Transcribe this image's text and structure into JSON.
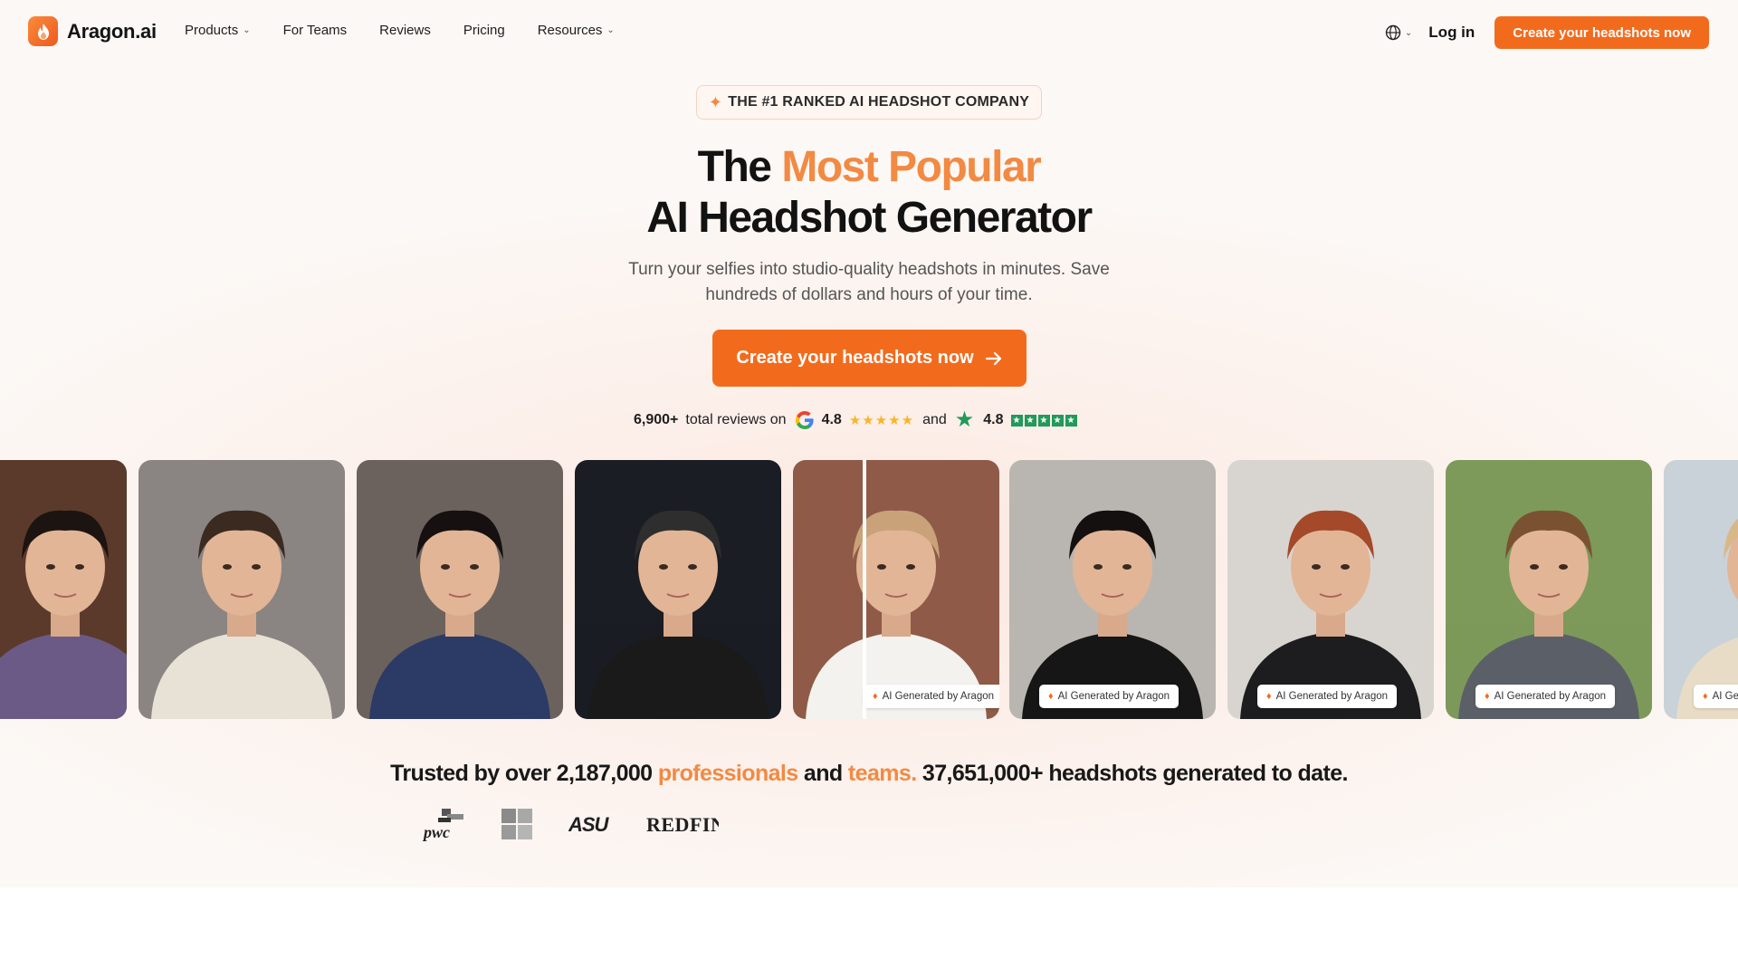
{
  "nav": {
    "brand": "Aragon.ai",
    "links": [
      {
        "label": "Products",
        "dropdown": true
      },
      {
        "label": "For Teams",
        "dropdown": false
      },
      {
        "label": "Reviews",
        "dropdown": false
      },
      {
        "label": "Pricing",
        "dropdown": false
      },
      {
        "label": "Resources",
        "dropdown": true
      }
    ],
    "login": "Log in",
    "cta": "Create your headshots now"
  },
  "hero": {
    "badge": "THE #1 RANKED AI HEADSHOT COMPANY",
    "title_prefix": "The ",
    "title_accent": "Most Popular",
    "title_line2": "AI Headshot Generator",
    "subtitle": "Turn your selfies into studio-quality headshots in minutes. Save hundreds of dollars and hours of your time.",
    "cta": "Create your headshots now"
  },
  "reviews": {
    "count": "6,900+",
    "text": "total reviews on",
    "google_rating": "4.8",
    "joiner": "and",
    "trustpilot_rating": "4.8"
  },
  "carousel": {
    "ai_label": "AI Generated by Aragon",
    "cards": [
      {
        "type": "selfie",
        "bg": "#5b3a2c",
        "shirt": "#6b5a86",
        "hair": "#1c1410"
      },
      {
        "type": "selfie",
        "bg": "#8a8582",
        "shirt": "#e8e2d6",
        "hair": "#3a2a20"
      },
      {
        "type": "selfie",
        "bg": "#6b625d",
        "shirt": "#2c3a66",
        "hair": "#161010"
      },
      {
        "type": "selfie",
        "bg": "#1b1d24",
        "shirt": "#1a1a1a",
        "hair": "#2e2e2e"
      },
      {
        "type": "split",
        "bg": "#8f5a48",
        "shirt": "#f4f2ee",
        "hair": "#c9a27a"
      },
      {
        "type": "generated",
        "bg": "#b9b6b1",
        "shirt": "#161616",
        "hair": "#141010"
      },
      {
        "type": "generated",
        "bg": "#d8d5d0",
        "shirt": "#1d1d1f",
        "hair": "#a4492a"
      },
      {
        "type": "generated",
        "bg": "#7d9a5a",
        "shirt": "#5b6068",
        "hair": "#7a5232"
      },
      {
        "type": "generated",
        "bg": "#c9d2d8",
        "shirt": "#e8dcc6",
        "hair": "#d8b88a"
      }
    ]
  },
  "trust": {
    "prefix": "Trusted by over 2,187,000 ",
    "professionals": "professionals",
    "and": " and ",
    "teams": "teams.",
    "suffix": " 37,651,000+ headshots generated to date."
  },
  "logos": [
    "pwc",
    "microsoft",
    "ASU",
    "REDFIN"
  ],
  "colors": {
    "brand": "#f26b1d",
    "accent": "#f28a43",
    "trustpilot": "#219a5a",
    "star": "#f7b52b"
  }
}
